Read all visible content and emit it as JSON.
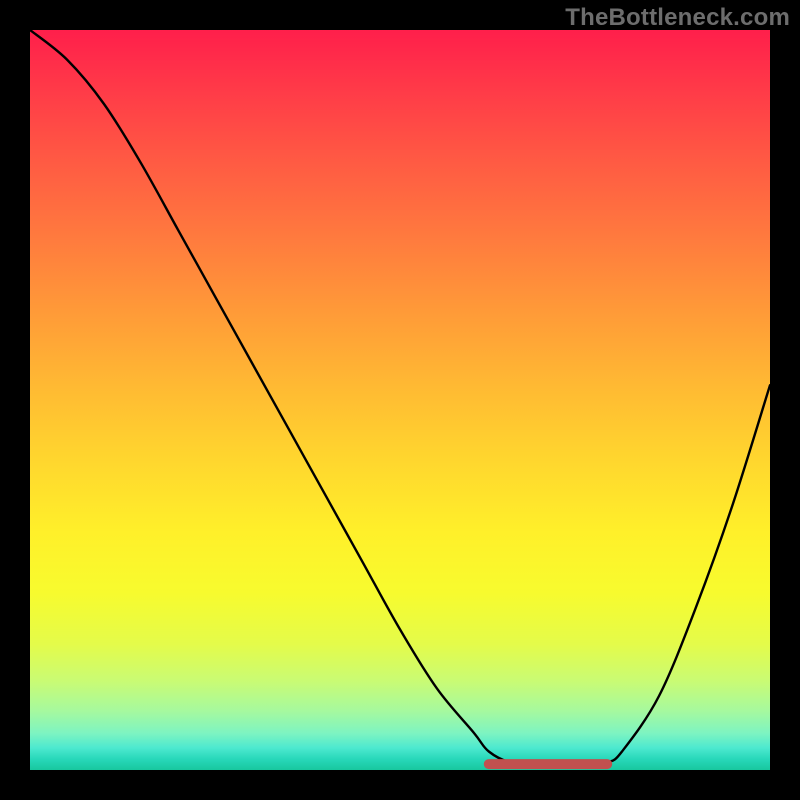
{
  "watermark": "TheBottleneck.com",
  "colors": {
    "background": "#000000",
    "curve": "#000000",
    "marker": "#c1504f",
    "watermark": "#6d6d6d"
  },
  "chart_data": {
    "type": "line",
    "title": "",
    "xlabel": "",
    "ylabel": "",
    "xlim": [
      0,
      100
    ],
    "ylim": [
      0,
      100
    ],
    "x": [
      0,
      5,
      10,
      15,
      20,
      25,
      30,
      35,
      40,
      45,
      50,
      55,
      60,
      62,
      65,
      70,
      75,
      78,
      80,
      85,
      90,
      95,
      100
    ],
    "values": [
      100,
      96,
      90,
      82,
      73,
      64,
      55,
      46,
      37,
      28,
      19,
      11,
      5,
      2.5,
      1.0,
      0.5,
      0.5,
      1.0,
      2.5,
      10,
      22,
      36,
      52
    ],
    "flat_region": {
      "x_start": 62,
      "x_end": 78,
      "y": 0.8
    },
    "background_gradient": {
      "orientation": "vertical",
      "stops": [
        {
          "pos": 0.0,
          "color": "#ff1f4b"
        },
        {
          "pos": 0.18,
          "color": "#ff5b43"
        },
        {
          "pos": 0.38,
          "color": "#ff9a38"
        },
        {
          "pos": 0.58,
          "color": "#ffd62e"
        },
        {
          "pos": 0.76,
          "color": "#f7fb2e"
        },
        {
          "pos": 0.92,
          "color": "#a6f99e"
        },
        {
          "pos": 1.0,
          "color": "#18c79e"
        }
      ]
    }
  }
}
